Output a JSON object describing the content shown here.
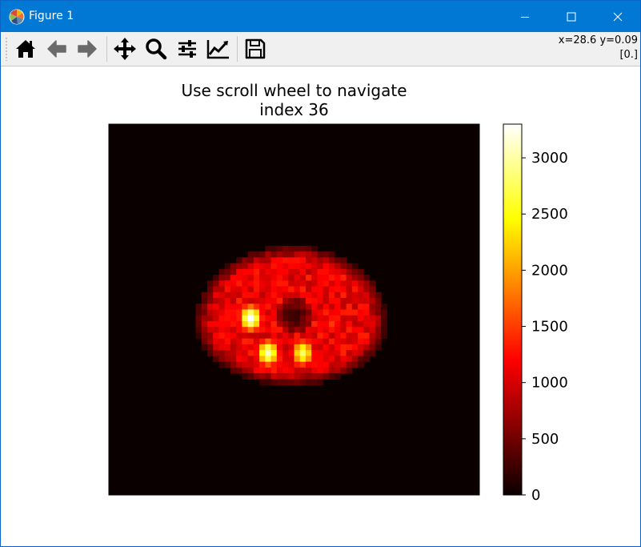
{
  "window": {
    "title": "Figure 1"
  },
  "toolbar": {
    "buttons": [
      {
        "name": "home-button",
        "icon": "home-icon"
      },
      {
        "name": "back-button",
        "icon": "arrow-left-icon"
      },
      {
        "name": "forward-button",
        "icon": "arrow-right-icon"
      },
      {
        "name": "pan-button",
        "icon": "move-icon"
      },
      {
        "name": "zoom-button",
        "icon": "magnifier-icon"
      },
      {
        "name": "subplots-button",
        "icon": "sliders-icon"
      },
      {
        "name": "customize-button",
        "icon": "line-chart-icon"
      },
      {
        "name": "save-button",
        "icon": "floppy-disk-icon"
      }
    ],
    "coords_line1": "x=28.6 y=0.09",
    "coords_line2": "[0.]"
  },
  "figure": {
    "title_line1": "Use scroll wheel to navigate",
    "title_line2": "index 36"
  },
  "chart_data": {
    "type": "heatmap",
    "title": "Use scroll wheel to navigate\nindex 36",
    "colormap": "hot",
    "grid": false,
    "image_size": [
      64,
      64
    ],
    "colorbar": {
      "vmin": 0,
      "vmax": 3300,
      "ticks": [
        0,
        500,
        1000,
        1500,
        2000,
        2500,
        3000
      ],
      "tick_labels": [
        "0",
        "500",
        "1000",
        "1500",
        "2000",
        "2500",
        "3000"
      ]
    },
    "background_value": 0,
    "body_region": {
      "x_range": [
        15,
        48
      ],
      "y_range": [
        21,
        47
      ],
      "typical_value": 1100
    },
    "hot_spots": [
      {
        "x": 24,
        "y": 33,
        "value": 3300
      },
      {
        "x": 27,
        "y": 39,
        "value": 3100
      },
      {
        "x": 33,
        "y": 39,
        "value": 2800
      },
      {
        "x": 38,
        "y": 34,
        "value": 1500
      }
    ]
  }
}
